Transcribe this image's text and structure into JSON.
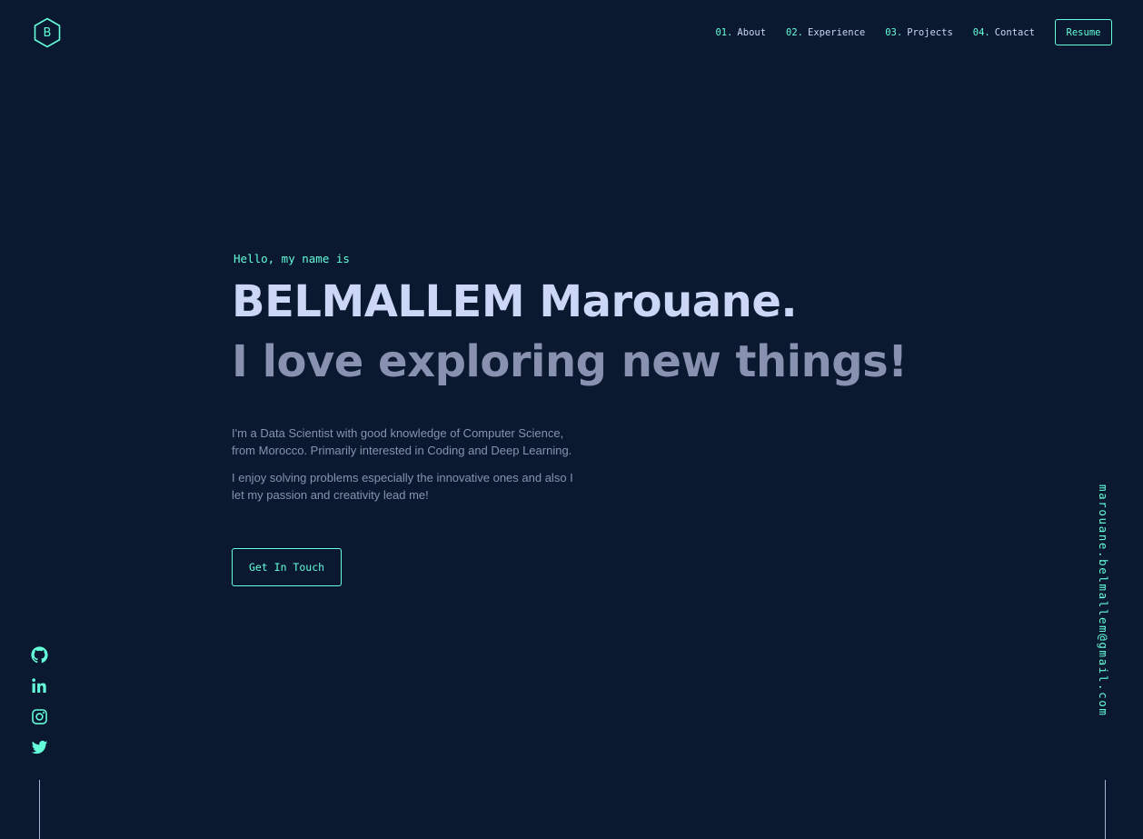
{
  "header": {
    "logo_letter": "B",
    "nav": [
      {
        "num": "01.",
        "label": "About"
      },
      {
        "num": "02.",
        "label": "Experience"
      },
      {
        "num": "03.",
        "label": "Projects"
      },
      {
        "num": "04.",
        "label": "Contact"
      }
    ],
    "resume_label": "Resume"
  },
  "hero": {
    "greeting": "Hello, my name is",
    "name": "BELMALLEM Marouane.",
    "tagline": "I love exploring new things!",
    "bio": [
      "I'm a Data Scientist with good knowledge of Computer Science, from Morocco. Primarily interested in Coding and Deep Learning.",
      "I enjoy solving problems especially the innovative ones and also I let my passion and creativity lead me!"
    ],
    "cta_label": "Get In Touch"
  },
  "social": [
    {
      "icon": "github-icon"
    },
    {
      "icon": "linkedin-icon"
    },
    {
      "icon": "instagram-icon"
    },
    {
      "icon": "twitter-icon"
    }
  ],
  "email": "marouane.belmallem@gmail.com",
  "colors": {
    "background": "#0a192f",
    "accent": "#64ffda",
    "heading": "#ccd6f6",
    "body": "#8892b0"
  }
}
